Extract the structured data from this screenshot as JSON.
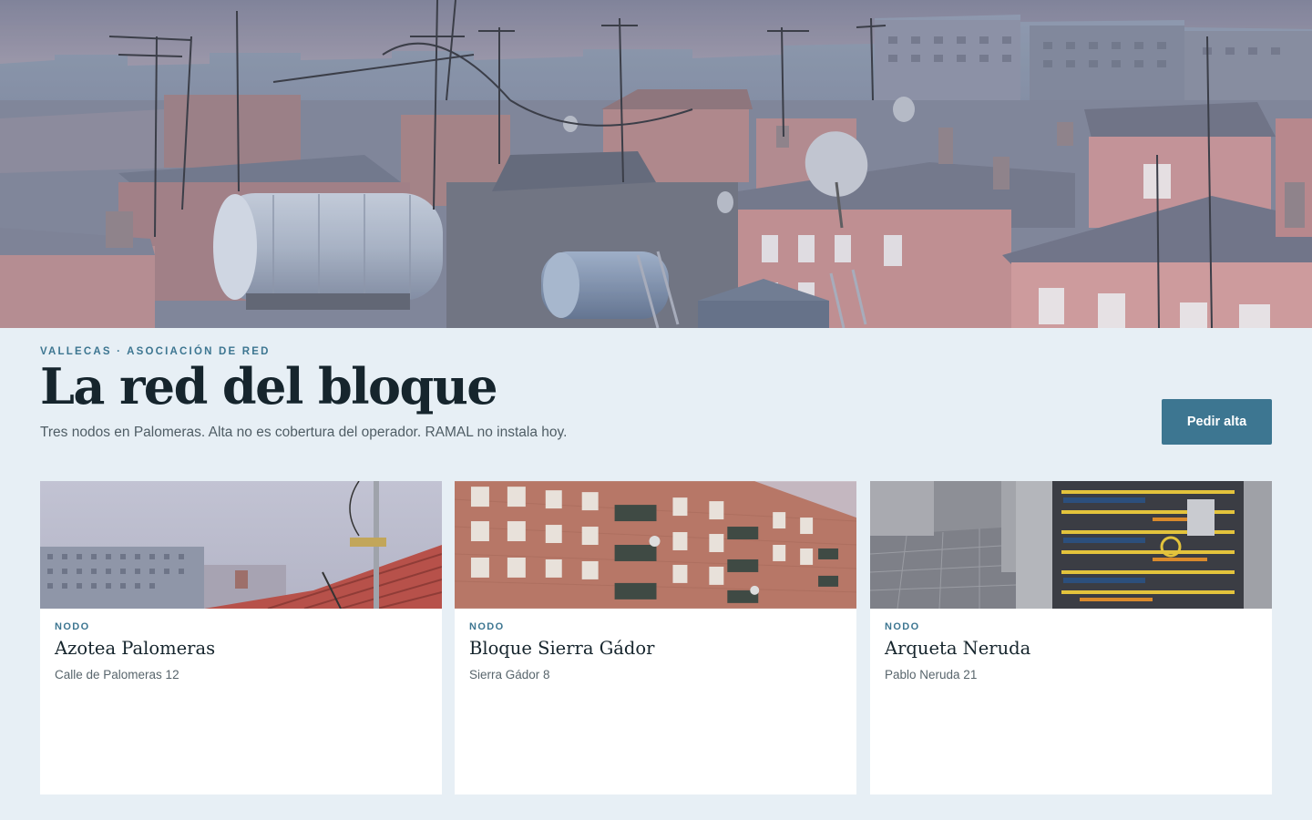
{
  "hero": {
    "image_alt": "rooftops",
    "image_icon": "rooftops-photo"
  },
  "header": {
    "eyebrow": "VALLECAS · ASOCIACIÓN DE RED",
    "title": "La red del bloque",
    "subtitle": "Tres nodos en Palomeras. Alta no es cobertura del operador. RAMAL no instala hoy."
  },
  "actions": {
    "cta_label": "Pedir alta"
  },
  "nodes": [
    {
      "kicker": "NODO",
      "name": "Azotea Palomeras",
      "address": "Calle de Palomeras 12",
      "image_icon": "rooftop-antenna-photo"
    },
    {
      "kicker": "NODO",
      "name": "Bloque Sierra Gádor",
      "address": "Sierra Gádor 8",
      "image_icon": "brick-building-photo"
    },
    {
      "kicker": "NODO",
      "name": "Arqueta Neruda",
      "address": "Pablo Neruda 21",
      "image_icon": "fiber-cabinet-photo"
    }
  ],
  "colors": {
    "accent": "#3d7691",
    "background": "#e7eff5",
    "card": "#ffffff",
    "title": "#16252d"
  }
}
